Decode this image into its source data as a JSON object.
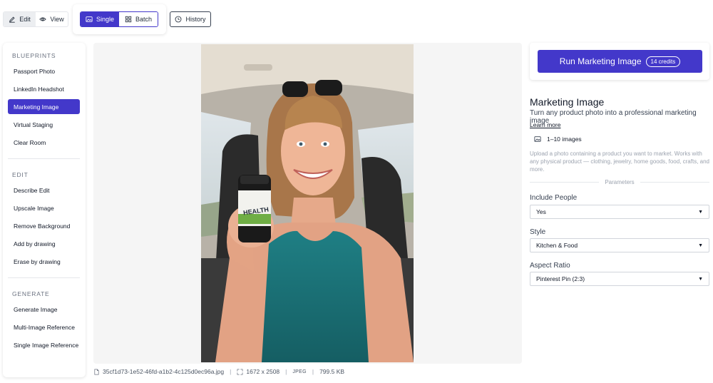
{
  "toolbar": {
    "edit_label": "Edit",
    "view_label": "View",
    "single_label": "Single",
    "batch_label": "Batch",
    "history_label": "History"
  },
  "sidebar": {
    "blueprints_header": "BLUEPRINTS",
    "blueprints": [
      "Passport Photo",
      "LinkedIn Headshot",
      "Marketing Image",
      "Virtual Staging",
      "Clear Room"
    ],
    "edit_header": "EDIT",
    "edit_items": [
      "Describe Edit",
      "Upscale Image",
      "Remove Background",
      "Add by drawing",
      "Erase by drawing"
    ],
    "generate_header": "GENERATE",
    "generate_items": [
      "Generate Image",
      "Multi-Image Reference",
      "Single Image Reference"
    ],
    "active_item": "Marketing Image"
  },
  "canvas": {
    "file_name": "35cf1d73-1e52-46fd-a1b2-4c125d0ec96a.jpg",
    "dimensions": "1672 x 2508",
    "format": "JPEG",
    "file_size": "799.5 KB",
    "bottle_text": "HEALTH"
  },
  "panel": {
    "run_label": "Run Marketing Image",
    "credits": "14 credits",
    "title": "Marketing Image",
    "subtitle": "Turn any product photo into a professional marketing image",
    "learn_more": "Learn more",
    "images_range": "1–10 images",
    "description": "Upload a photo containing a product you want to market. Works with any physical product — clothing, jewelry, home goods, food, crafts, and more.",
    "parameters_label": "Parameters",
    "fields": [
      {
        "label": "Include People",
        "value": "Yes"
      },
      {
        "label": "Style",
        "value": "Kitchen & Food"
      },
      {
        "label": "Aspect Ratio",
        "value": "Pinterest Pin (2:3)"
      }
    ]
  },
  "colors": {
    "accent": "#4338ca",
    "muted_text": "#9ca3af",
    "canvas_bg": "#f5f5f5"
  }
}
